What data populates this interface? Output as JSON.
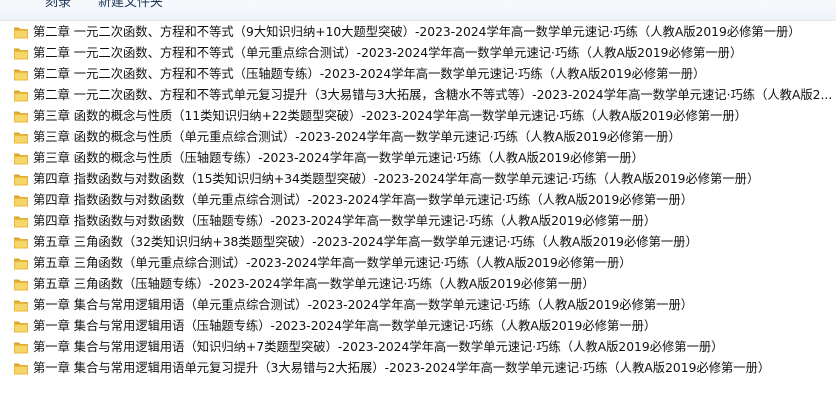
{
  "toolbar": {
    "left_label": "刻录",
    "right_label": "新建文件夹"
  },
  "files": [
    {
      "name": "第二章 一元二次函数、方程和不等式（9大知识归纳+10大题型突破）-2023-2024学年高一数学单元速记·巧练（人教A版2019必修第一册）",
      "icon": "folder-icon"
    },
    {
      "name": "第二章 一元二次函数、方程和不等式（单元重点综合测试）-2023-2024学年高一数学单元速记·巧练（人教A版2019必修第一册）",
      "icon": "folder-icon"
    },
    {
      "name": "第二章 一元二次函数、方程和不等式（压轴题专练）-2023-2024学年高一数学单元速记·巧练（人教A版2019必修第一册）",
      "icon": "folder-icon"
    },
    {
      "name": "第二章 一元二次函数、方程和不等式单元复习提升（3大易错与3大拓展，含糖水不等式等）-2023-2024学年高一数学单元速记·巧练（人教A版2...",
      "icon": "folder-icon"
    },
    {
      "name": "第三章 函数的概念与性质（11类知识归纳+22类题型突破）-2023-2024学年高一数学单元速记·巧练（人教A版2019必修第一册）",
      "icon": "folder-icon"
    },
    {
      "name": "第三章 函数的概念与性质（单元重点综合测试）-2023-2024学年高一数学单元速记·巧练（人教A版2019必修第一册）",
      "icon": "folder-icon"
    },
    {
      "name": "第三章 函数的概念与性质（压轴题专练）-2023-2024学年高一数学单元速记·巧练（人教A版2019必修第一册）",
      "icon": "folder-icon"
    },
    {
      "name": "第四章 指数函数与对数函数（15类知识归纳+34类题型突破）-2023-2024学年高一数学单元速记·巧练（人教A版2019必修第一册）",
      "icon": "folder-icon"
    },
    {
      "name": "第四章 指数函数与对数函数（单元重点综合测试）-2023-2024学年高一数学单元速记·巧练（人教A版2019必修第一册）",
      "icon": "folder-icon"
    },
    {
      "name": "第四章 指数函数与对数函数（压轴题专练）-2023-2024学年高一数学单元速记·巧练（人教A版2019必修第一册）",
      "icon": "folder-icon"
    },
    {
      "name": "第五章 三角函数（32类知识归纳+38类题型突破）-2023-2024学年高一数学单元速记·巧练（人教A版2019必修第一册）",
      "icon": "folder-icon"
    },
    {
      "name": "第五章 三角函数（单元重点综合测试）-2023-2024学年高一数学单元速记·巧练（人教A版2019必修第一册）",
      "icon": "folder-icon"
    },
    {
      "name": "第五章 三角函数（压轴题专练）-2023-2024学年高一数学单元速记·巧练（人教A版2019必修第一册）",
      "icon": "folder-icon"
    },
    {
      "name": "第一章 集合与常用逻辑用语（单元重点综合测试）-2023-2024学年高一数学单元速记·巧练（人教A版2019必修第一册）",
      "icon": "folder-icon"
    },
    {
      "name": "第一章 集合与常用逻辑用语（压轴题专练）-2023-2024学年高一数学单元速记·巧练（人教A版2019必修第一册）",
      "icon": "folder-icon"
    },
    {
      "name": "第一章 集合与常用逻辑用语（知识归纳+7类题型突破）-2023-2024学年高一数学单元速记·巧练（人教A版2019必修第一册）",
      "icon": "folder-icon"
    },
    {
      "name": "第一章 集合与常用逻辑用语单元复习提升（3大易错与2大拓展）-2023-2024学年高一数学单元速记·巧练（人教A版2019必修第一册）",
      "icon": "folder-icon"
    }
  ],
  "colors": {
    "folder_body": "#e8b93d",
    "folder_front": "#f6d66b",
    "folder_tab": "#d9a42a",
    "text": "#111111"
  }
}
